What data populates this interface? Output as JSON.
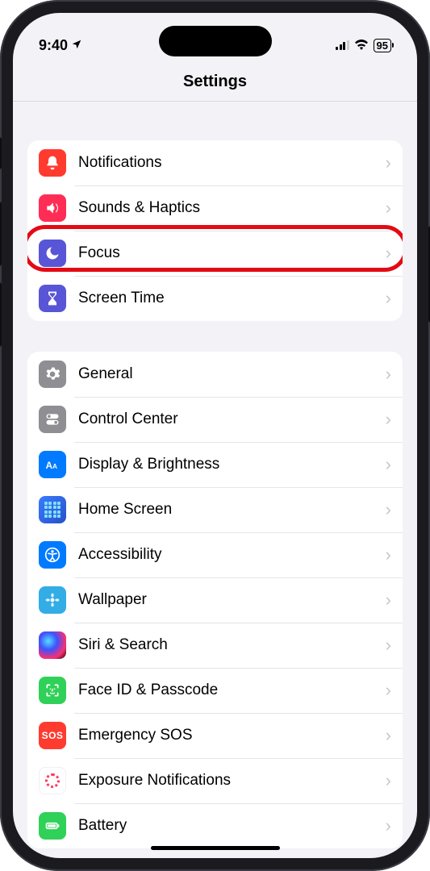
{
  "status": {
    "time": "9:40",
    "battery": "95"
  },
  "header": {
    "title": "Settings"
  },
  "section1": {
    "notifications": "Notifications",
    "sounds": "Sounds & Haptics",
    "focus": "Focus",
    "screentime": "Screen Time"
  },
  "section2": {
    "general": "General",
    "controlcenter": "Control Center",
    "display": "Display & Brightness",
    "homescreen": "Home Screen",
    "accessibility": "Accessibility",
    "wallpaper": "Wallpaper",
    "siri": "Siri & Search",
    "faceid": "Face ID & Passcode",
    "emergency": "Emergency SOS",
    "exposure": "Exposure Notifications",
    "battery": "Battery"
  }
}
